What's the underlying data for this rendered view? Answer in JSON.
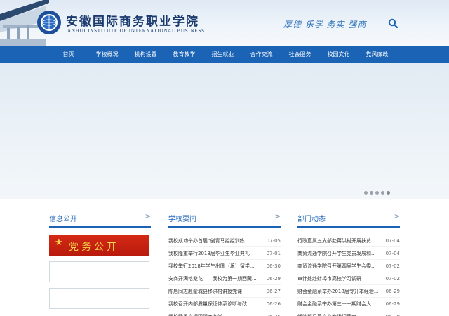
{
  "header": {
    "school_name_cn": "安徽国际商务职业学院",
    "school_name_en": "ANHUI INSTITUTE OF INTERNATIONAL BUSINESS",
    "motto": "厚德 乐学 务实 强商",
    "search_icon": "search-icon"
  },
  "colors": {
    "nav_bg": "#1b63b5",
    "accent": "#1b63b5",
    "banner_red": "#c8200f",
    "banner_gold": "#f5d44a"
  },
  "nav": {
    "items": [
      "首页",
      "学校概况",
      "机构设置",
      "教育教学",
      "招生就业",
      "合作交流",
      "社会服务",
      "校园文化",
      "党风廉政"
    ]
  },
  "banner": {
    "dot_count": 5,
    "active_index": 4
  },
  "info_open": {
    "title": "信息公开",
    "more": ">",
    "banner_text": "党务公开"
  },
  "school_news": {
    "title": "学校要闻",
    "more": ">",
    "items": [
      {
        "title": "我校成功举办首届“创青马控控训练...",
        "date": "07-05"
      },
      {
        "title": "我校隆重举行2018届毕业生毕业典礼",
        "date": "07-01"
      },
      {
        "title": "我校举行2018年学生出国（境）留学...",
        "date": "06-30"
      },
      {
        "title": "安商开满格桑花——我校为第一期西藏...",
        "date": "06-29"
      },
      {
        "title": "陈启同志赴蒙城县移洪村讲授党课",
        "date": "06-27"
      },
      {
        "title": "我校召开内部质量保证体系诊断与改...",
        "date": "06-26"
      },
      {
        "title": "我校隆重举行国际商务学...",
        "date": "06-25"
      }
    ]
  },
  "dept_news": {
    "title": "部门动态",
    "more": ">",
    "items": [
      {
        "title": "行政直属五支部赴蒋洪村开展扶贫...",
        "date": "07-04"
      },
      {
        "title": "商贸流通学院召开学生党员发展和...",
        "date": "07-04"
      },
      {
        "title": "商贸流通学院召开第四届学生会委...",
        "date": "07-02"
      },
      {
        "title": "审计处赴蚌埠市高校学习调研",
        "date": "07-02"
      },
      {
        "title": "财会金融系举办2018届专升本经验...",
        "date": "06-29"
      },
      {
        "title": "财会金融系举办第三十一期财会大...",
        "date": "06-29"
      },
      {
        "title": "经济贸易系举办专场招聘会...",
        "date": "06-28"
      }
    ]
  }
}
